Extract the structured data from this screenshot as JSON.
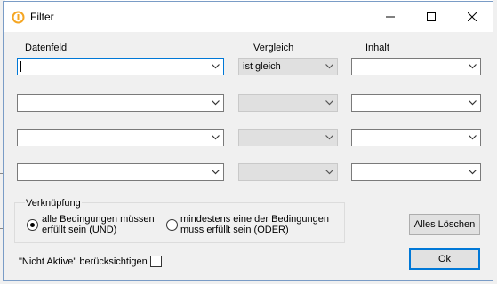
{
  "window": {
    "title": "Filter"
  },
  "headers": {
    "field": "Datenfeld",
    "compare": "Vergleich",
    "content": "Inhalt"
  },
  "rows": [
    {
      "field": "",
      "compare": "ist gleich",
      "content": ""
    },
    {
      "field": "",
      "compare": "",
      "content": ""
    },
    {
      "field": "",
      "compare": "",
      "content": ""
    },
    {
      "field": "",
      "compare": "",
      "content": ""
    }
  ],
  "link_group": {
    "label": "Verknüpfung",
    "option_and": "alle Bedingungen müssen\nerfüllt sein (UND)",
    "option_or": "mindestens eine der Bedingungen\nmuss erfüllt sein (ODER)",
    "selected": "and"
  },
  "buttons": {
    "clear_all": "Alles Löschen",
    "ok": "Ok"
  },
  "inactive_checkbox": {
    "label": "\"Nicht Aktive\" berücksichtigen",
    "checked": false
  },
  "colors": {
    "accent": "#0078d7",
    "app_icon": "#f5a623"
  }
}
